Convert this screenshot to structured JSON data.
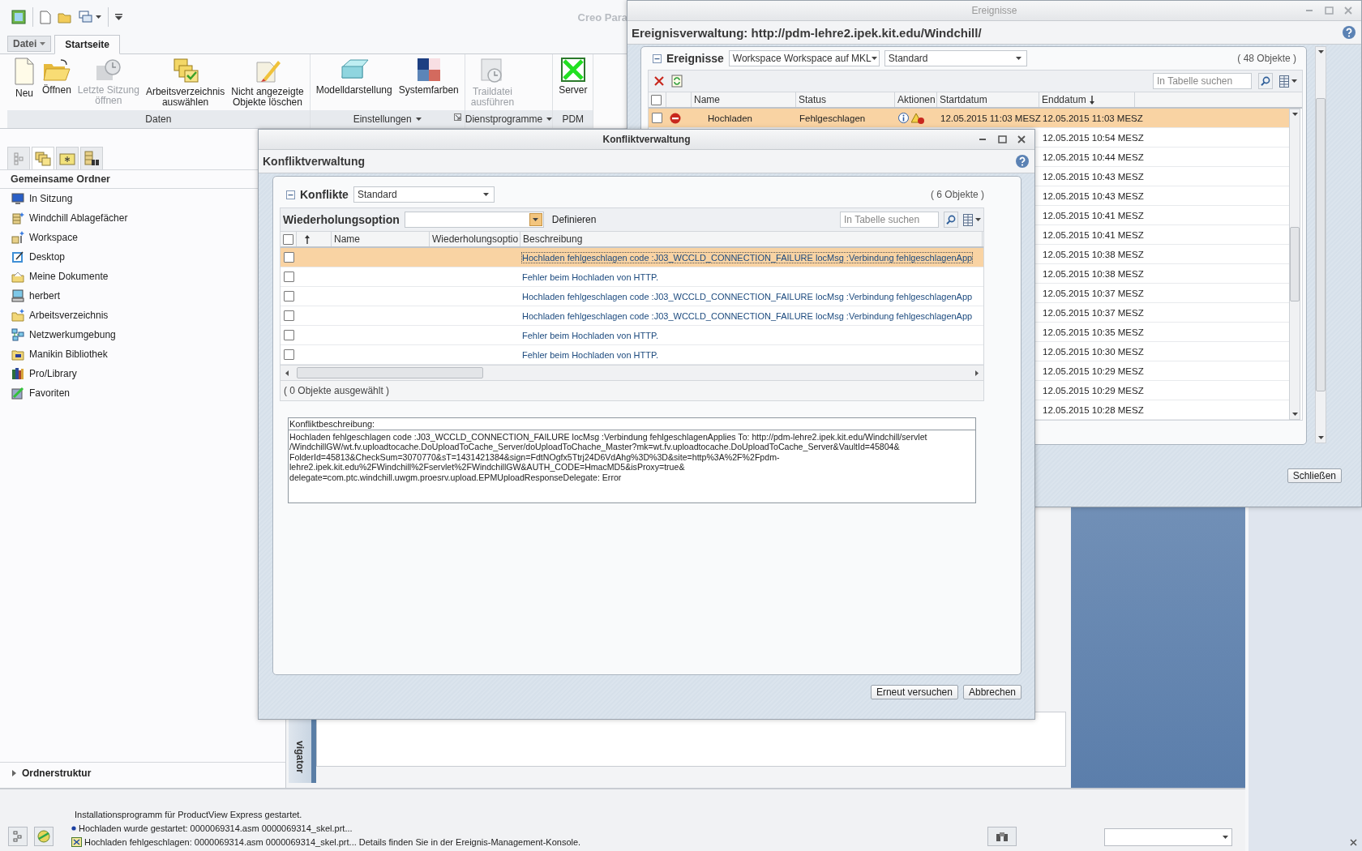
{
  "main_window": {
    "title": "Creo Para",
    "file_menu": "Datei",
    "tabs": [
      {
        "label": "Startseite",
        "selected": true
      }
    ],
    "ribbon_groups": [
      {
        "label": "Daten",
        "has_menu": false,
        "launcher": false,
        "buttons": [
          {
            "label": "Neu",
            "disabled": false
          },
          {
            "label": "Öffnen",
            "disabled": false
          },
          {
            "label": "Letzte Sitzung\nöffnen",
            "disabled": true
          },
          {
            "label": "Arbeitsverzeichnis\nauswählen",
            "disabled": false
          },
          {
            "label": "Nicht angezeigte\nObjekte löschen",
            "disabled": false
          }
        ]
      },
      {
        "label": "Einstellungen",
        "has_menu": true,
        "launcher": true,
        "buttons": [
          {
            "label": "Modelldarstellung",
            "disabled": false
          },
          {
            "label": "Systemfarben",
            "disabled": false
          }
        ]
      },
      {
        "label": "Dienstprogramme",
        "has_menu": true,
        "launcher": false,
        "buttons": [
          {
            "label": "Traildatei\nausführen",
            "disabled": true
          }
        ]
      },
      {
        "label": "PDM",
        "has_menu": false,
        "launcher": false,
        "buttons": [
          {
            "label": "Server",
            "disabled": false
          }
        ]
      }
    ],
    "navigator": {
      "tabs": [
        {
          "selected": false
        },
        {
          "selected": true
        },
        {
          "selected": false
        },
        {
          "selected": false
        }
      ],
      "heading": "Gemeinsame Ordner",
      "items": [
        {
          "label": "In Sitzung"
        },
        {
          "label": "Windchill Ablagefächer"
        },
        {
          "label": "Workspace"
        },
        {
          "label": "Desktop"
        },
        {
          "label": "Meine Dokumente"
        },
        {
          "label": "herbert"
        },
        {
          "label": "Arbeitsverzeichnis"
        },
        {
          "label": "Netzwerkumgebung"
        },
        {
          "label": "Manikin Bibliothek"
        },
        {
          "label": "Pro/Library"
        },
        {
          "label": "Favoriten"
        }
      ],
      "footer": {
        "label": "Ordnerstruktur",
        "expanded": false
      }
    },
    "side_tab": "vigator",
    "status_messages": [
      {
        "text": "Installationsprogramm für ProductView Express gestartet.",
        "kind": "plain"
      },
      {
        "text": "Hochladen wurde gestartet: 0000069314.asm 0000069314_skel.prt...",
        "kind": "bullet"
      },
      {
        "text": "Hochladen fehlgeschlagen: 0000069314.asm 0000069314_skel.prt... Details finden Sie in der Ereignis-Management-Konsole.",
        "kind": "error"
      }
    ]
  },
  "events_window": {
    "title": "Ereignisse",
    "heading": "Ereignisverwaltung: http://pdm-lehre2.ipek.kit.edu/Windchill/",
    "panel_title": "Ereignisse",
    "expanded": true,
    "filter": "Workspace Workspace auf MKL",
    "view": "Standard",
    "count": "( 48 Objekte )",
    "search_placeholder": "In Tabelle suchen",
    "all_checked": false,
    "columns": [
      {
        "label": "Name"
      },
      {
        "label": "Status"
      },
      {
        "label": "Aktionen"
      },
      {
        "label": "Startdatum"
      },
      {
        "label": "Enddatum",
        "sort_ascending": false
      }
    ],
    "rows": [
      {
        "name": "Hochladen",
        "status": "Fehlgeschlagen",
        "start": "12.05.2015 11:03 MESZ",
        "end": "12.05.2015 11:03 MESZ",
        "failed": true,
        "checked": false,
        "selected": true
      },
      {
        "end": "12.05.2015 10:54 MESZ",
        "selected": false
      },
      {
        "end": "12.05.2015 10:44 MESZ",
        "selected": false
      },
      {
        "end": "12.05.2015 10:43 MESZ",
        "selected": false
      },
      {
        "end": "12.05.2015 10:43 MESZ",
        "selected": false
      },
      {
        "end": "12.05.2015 10:41 MESZ",
        "selected": false
      },
      {
        "end": "12.05.2015 10:41 MESZ",
        "selected": false
      },
      {
        "end": "12.05.2015 10:38 MESZ",
        "selected": false
      },
      {
        "end": "12.05.2015 10:38 MESZ",
        "selected": false
      },
      {
        "end": "12.05.2015 10:37 MESZ",
        "selected": false
      },
      {
        "end": "12.05.2015 10:37 MESZ",
        "selected": false
      },
      {
        "end": "12.05.2015 10:35 MESZ",
        "selected": false
      },
      {
        "end": "12.05.2015 10:30 MESZ",
        "selected": false
      },
      {
        "end": "12.05.2015 10:29 MESZ",
        "selected": false
      },
      {
        "end": "12.05.2015 10:29 MESZ",
        "selected": false
      },
      {
        "end": "12.05.2015 10:28 MESZ",
        "selected": false
      }
    ],
    "close_button": "Schließen"
  },
  "conflict_dialog": {
    "title": "Konfliktverwaltung",
    "heading": "Konfliktverwaltung",
    "panel_title": "Konflikte",
    "expanded": true,
    "view": "Standard",
    "count": "( 6 Objekte )",
    "retry_label": "Wiederholungsoption",
    "define_button": "Definieren",
    "search_placeholder": "In Tabelle suchen",
    "all_checked": false,
    "columns": [
      {
        "sort_ascending": true
      },
      {
        "label": "Name"
      },
      {
        "label": "Wiederholungsoptio"
      },
      {
        "label": "Beschreibung"
      }
    ],
    "rows": [
      {
        "description": "Hochladen fehlgeschlagen code :J03_WCCLD_CONNECTION_FAILURE locMsg :Verbindung fehlgeschlagenApp",
        "checked": false,
        "selected": true
      },
      {
        "description": "Fehler beim Hochladen von HTTP.",
        "checked": false,
        "selected": false
      },
      {
        "description": "Hochladen fehlgeschlagen code :J03_WCCLD_CONNECTION_FAILURE locMsg :Verbindung fehlgeschlagenApp",
        "checked": false,
        "selected": false
      },
      {
        "description": "Hochladen fehlgeschlagen code :J03_WCCLD_CONNECTION_FAILURE locMsg :Verbindung fehlgeschlagenApp",
        "checked": false,
        "selected": false
      },
      {
        "description": "Fehler beim Hochladen von HTTP.",
        "checked": false,
        "selected": false
      },
      {
        "description": "Fehler beim Hochladen von HTTP.",
        "checked": false,
        "selected": false
      }
    ],
    "selection_info": "( 0 Objekte ausgewählt )",
    "description_label": "Konfliktbeschreibung:",
    "description": "Hochladen fehlgeschlagen code :J03_WCCLD_CONNECTION_FAILURE locMsg :Verbindung fehlgeschlagenApplies To: http://pdm-lehre2.ipek.kit.edu/Windchill/servlet\n/WindchillGW/wt.fv.uploadtocache.DoUploadToCache_Server/doUploadToChache_Master?mk=wt.fv.uploadtocache.DoUploadToCache_Server&VaultId=45804&\nFolderId=45813&CheckSum=3070770&sT=1431421384&sign=FdtNOgfx5Ttrj24D6VdAhg%3D%3D&site=http%3A%2F%2Fpdm-\nlehre2.ipek.kit.edu%2FWindchill%2Fservlet%2FWindchillGW&AUTH_CODE=HmacMD5&isProxy=true&\ndelegate=com.ptc.windchill.uwgm.proesrv.upload.EPMUploadResponseDelegate: Error",
    "buttons": [
      {
        "label": "Erneut versuchen"
      },
      {
        "label": "Abbrechen"
      }
    ]
  }
}
